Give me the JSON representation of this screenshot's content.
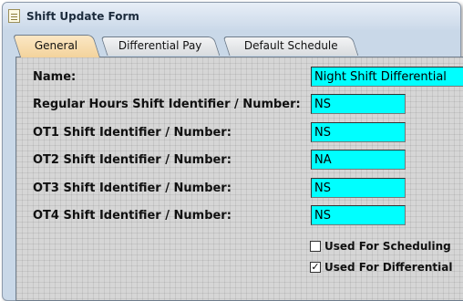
{
  "window": {
    "title": "Shift Update Form",
    "icon": "form-icon"
  },
  "tabs": [
    {
      "label": "General",
      "active": true
    },
    {
      "label": "Differential Pay",
      "active": false
    },
    {
      "label": "Default Schedule",
      "active": false
    }
  ],
  "form": {
    "name": {
      "label": "Name:",
      "value": "Night Shift Differential"
    },
    "regular": {
      "label": "Regular Hours Shift Identifier / Number:",
      "value": "NS"
    },
    "ot1": {
      "label": "OT1 Shift Identifier / Number:",
      "value": "NS"
    },
    "ot2": {
      "label": "OT2 Shift Identifier / Number:",
      "value": "NA"
    },
    "ot3": {
      "label": "OT3 Shift Identifier / Number:",
      "value": "NS"
    },
    "ot4": {
      "label": "OT4 Shift Identifier / Number:",
      "value": "NS"
    }
  },
  "checkboxes": {
    "scheduling": {
      "label": "Used For Scheduling",
      "checked": false,
      "mark": ""
    },
    "differential": {
      "label": "Used For Differential",
      "checked": true,
      "mark": "✓"
    }
  },
  "colors": {
    "field_bg": "#00ffff",
    "active_tab": "#f3d39c",
    "panel_bg": "#d6d6d6"
  }
}
